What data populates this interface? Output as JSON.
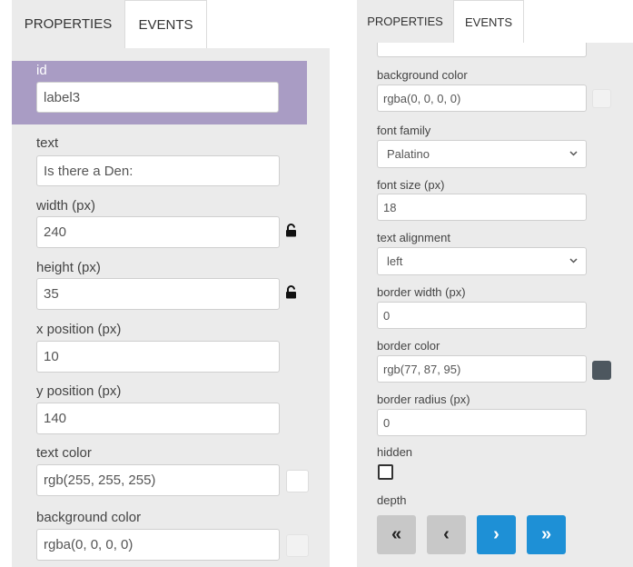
{
  "left": {
    "tabs": {
      "properties": "PROPERTIES",
      "events": "EVENTS"
    },
    "id": {
      "label": "id",
      "value": "label3"
    },
    "text": {
      "label": "text",
      "value": "Is there a Den:"
    },
    "width": {
      "label": "width (px)",
      "value": "240"
    },
    "height": {
      "label": "height (px)",
      "value": "35"
    },
    "x": {
      "label": "x position (px)",
      "value": "10"
    },
    "y": {
      "label": "y position (px)",
      "value": "140"
    },
    "text_color": {
      "label": "text color",
      "value": "rgb(255, 255, 255)"
    },
    "bg_color": {
      "label": "background color",
      "value": "rgba(0, 0, 0, 0)"
    },
    "icons": {
      "width_lock": "lock-icon",
      "height_lock": "lock-icon"
    }
  },
  "right": {
    "tabs": {
      "properties": "PROPERTIES",
      "events": "EVENTS"
    },
    "bg_color": {
      "label": "background color",
      "value": "rgba(0, 0, 0, 0)"
    },
    "font_family": {
      "label": "font family",
      "value": "Palatino"
    },
    "font_size": {
      "label": "font size (px)",
      "value": "18"
    },
    "text_align": {
      "label": "text alignment",
      "value": "left"
    },
    "border_width": {
      "label": "border width (px)",
      "value": "0"
    },
    "border_color": {
      "label": "border color",
      "value": "rgb(77, 87, 95)"
    },
    "border_radius": {
      "label": "border radius (px)",
      "value": "0"
    },
    "hidden": {
      "label": "hidden",
      "checked": false
    },
    "depth": {
      "label": "depth",
      "buttons": [
        {
          "glyph": "«",
          "name": "send-to-back"
        },
        {
          "glyph": "‹",
          "name": "send-backward"
        },
        {
          "glyph": "›",
          "name": "bring-forward"
        },
        {
          "glyph": "»",
          "name": "bring-to-front"
        }
      ]
    }
  },
  "colors": {
    "panel_bg": "#ebebeb",
    "selected_row": "#a99cc4",
    "depth_blue": "#1e90d6",
    "depth_grey": "#c8c8c8",
    "border_swatch": "#4d575f"
  }
}
